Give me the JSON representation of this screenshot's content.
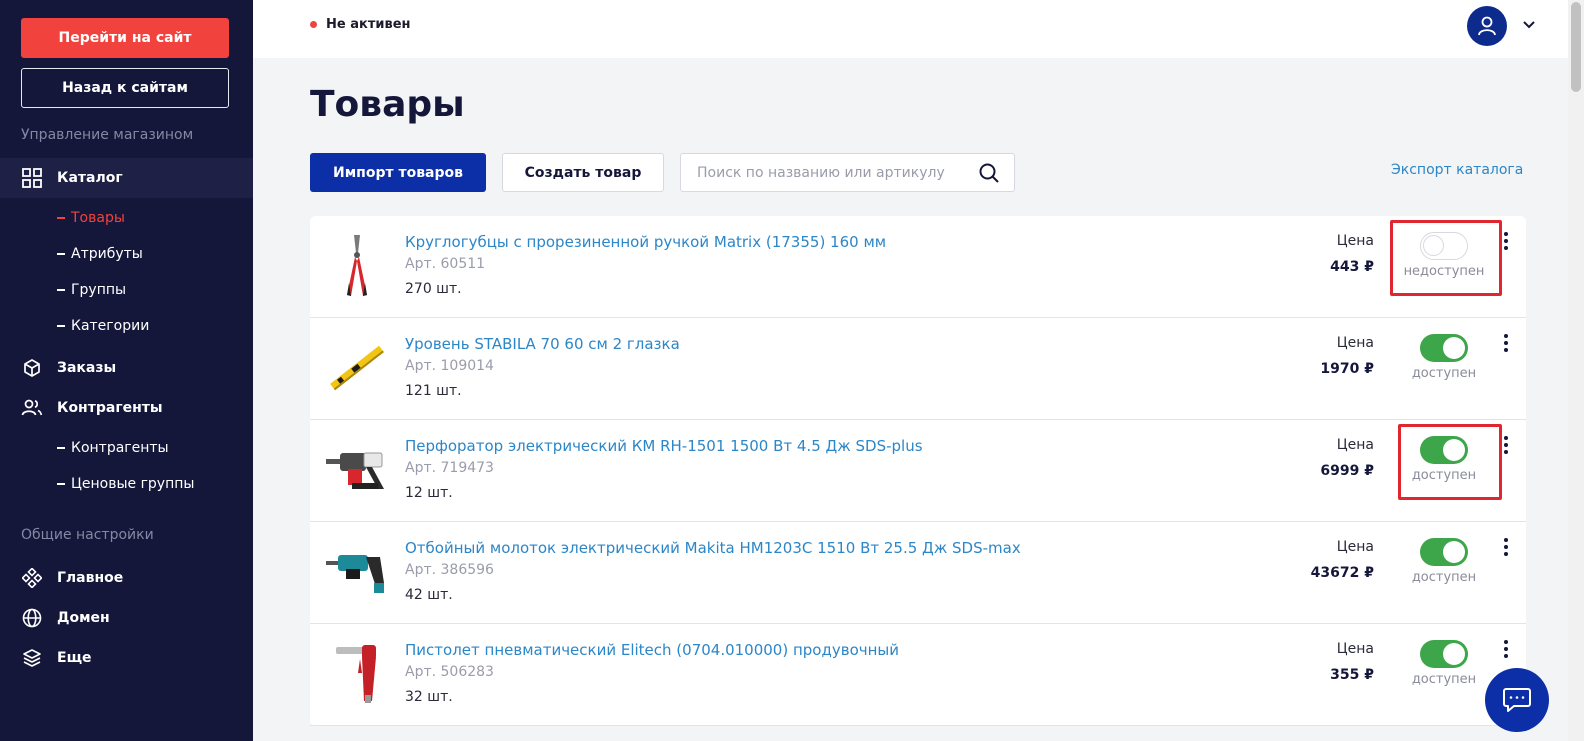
{
  "sidebar": {
    "go_site": "Перейти на сайт",
    "back_sites": "Назад к сайтам",
    "section_shop": "Управление магазином",
    "catalog": "Каталог",
    "catalog_items": [
      "Товары",
      "Атрибуты",
      "Группы",
      "Категории"
    ],
    "orders": "Заказы",
    "contractors": "Контрагенты",
    "contractors_items": [
      "Контрагенты",
      "Ценовые группы"
    ],
    "section_general": "Общие настройки",
    "main": "Главное",
    "domain": "Домен",
    "more": "Еще"
  },
  "topbar": {
    "status": "Не активен"
  },
  "page": {
    "title": "Товары",
    "import_label": "Импорт товаров",
    "create_label": "Создать товар",
    "search_placeholder": "Поиск по названию или артикулу",
    "export_label": "Экспорт каталога"
  },
  "products": [
    {
      "name": "Круглогубцы с прорезиненной ручкой Matrix (17355) 160 мм",
      "article": "Арт. 60511",
      "qty": "270 шт.",
      "price_label": "Цена",
      "price": "443 ₽",
      "available": false,
      "status": "недоступен",
      "highlighted": true
    },
    {
      "name": "Уровень STABILA 70 60 см 2 глазка",
      "article": "Арт. 109014",
      "qty": "121 шт.",
      "price_label": "Цена",
      "price": "1970 ₽",
      "available": true,
      "status": "доступен",
      "highlighted": false
    },
    {
      "name": "Перфоратор электрический КМ RH-1501 1500 Вт 4.5 Дж SDS-plus",
      "article": "Арт. 719473",
      "qty": "12 шт.",
      "price_label": "Цена",
      "price": "6999 ₽",
      "available": true,
      "status": "доступен",
      "highlighted": true
    },
    {
      "name": "Отбойный молоток электрический Makita HM1203C 1510 Вт 25.5 Дж SDS-max",
      "article": "Арт. 386596",
      "qty": "42 шт.",
      "price_label": "Цена",
      "price": "43672 ₽",
      "available": true,
      "status": "доступен",
      "highlighted": false
    },
    {
      "name": "Пистолет пневматический Elitech (0704.010000) продувочный",
      "article": "Арт. 506283",
      "qty": "32 шт.",
      "price_label": "Цена",
      "price": "355 ₽",
      "available": true,
      "status": "доступен",
      "highlighted": false
    }
  ],
  "colors": {
    "sidebar_bg": "#15173a",
    "accent_red": "#f2423d",
    "primary_blue": "#0c2ea6",
    "link_blue": "#2c86c7",
    "toggle_green": "#3ea64a"
  }
}
